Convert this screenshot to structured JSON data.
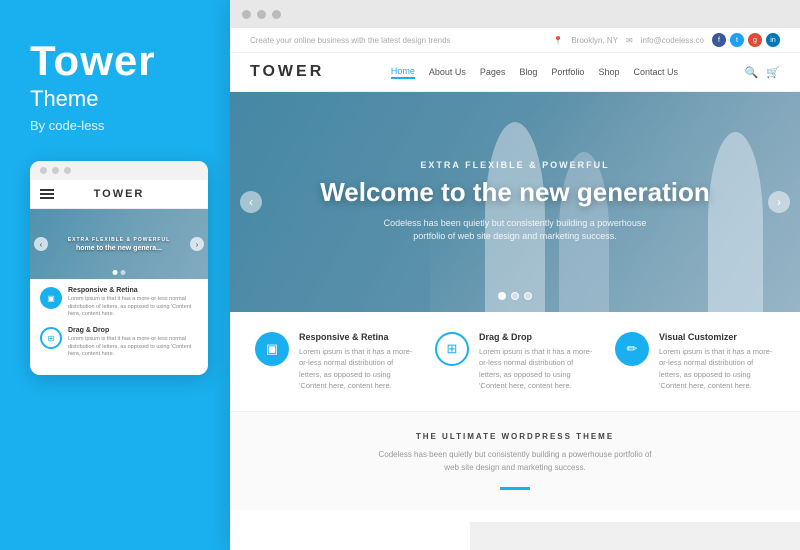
{
  "brand": {
    "title": "Tower",
    "subtitle": "Theme",
    "by": "By code-less"
  },
  "mobile_mockup": {
    "logo": "TOWER",
    "hero_text": "home to the new genera...",
    "features": [
      {
        "icon": "▣",
        "title": "Responsive & Retina",
        "desc": "Lorem ipsum is that it has a more-or-less normal distribution of letters, as opposed to using 'Content here, content here."
      },
      {
        "icon": "⊞",
        "title": "Drag & Drop",
        "desc": "Lorem ipsum is that it has a more-or-less normal distribution of letters, as opposed to using 'Content here."
      }
    ]
  },
  "desktop_mockup": {
    "top_info_left": "Create your online business with the latest design trends",
    "top_info_location": "Brooklyn, NY",
    "top_info_email": "info@codeless.co",
    "logo": "TOWER",
    "nav_links": [
      "Home",
      "About Us",
      "Pages",
      "Blog",
      "Portfolio",
      "Shop",
      "Contact Us"
    ],
    "hero": {
      "tagline": "EXTRA FLEXIBLE & POWERFUL",
      "title": "Welcome to the new generation",
      "desc": "Codeless has been quietly but consistently building a powerhouse portfolio of web site design and marketing success."
    },
    "features": [
      {
        "icon": "▣",
        "title": "Responsive & Retina",
        "desc": "Lorem ipsum is that it has a more-or-less normal distribution of letters, as opposed to using 'Content here, content here."
      },
      {
        "icon": "⊞",
        "title": "Drag & Drop",
        "desc": "Lorem ipsum is that it has a more-or-less normal distribution of letters, as opposed to using 'Content here, content here."
      },
      {
        "icon": "✏",
        "title": "Visual Customizer",
        "desc": "Lorem ipsum is that it has a more-or-less normal distribution of letters, as opposed to using 'Content here, content here."
      }
    ],
    "bottom": {
      "tag": "THE ULTIMATE WORDPRESS THEME",
      "desc": "Codeless has been quietly but consistently building a powerhouse portfolio of web site design and marketing success."
    }
  }
}
